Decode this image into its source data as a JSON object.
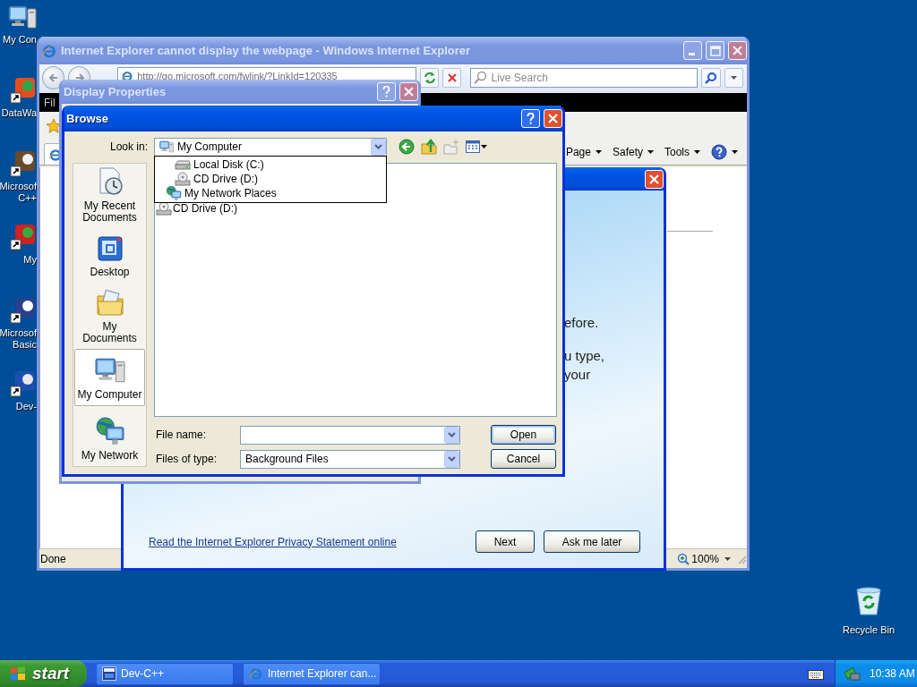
{
  "desktop": {
    "icons": [
      {
        "kind": "computer",
        "lines": [
          "My Con"
        ]
      },
      {
        "kind": "app",
        "lines": [
          "DataWa"
        ]
      },
      {
        "kind": "app",
        "lines": [
          "Microsof",
          "C++"
        ]
      },
      {
        "kind": "app",
        "lines": [
          "My"
        ]
      },
      {
        "kind": "app",
        "lines": [
          "Microsof",
          "Basic"
        ]
      },
      {
        "kind": "app",
        "lines": [
          "Dev-"
        ]
      }
    ],
    "recycle_bin": {
      "label": "Recycle Bin"
    }
  },
  "ie_window": {
    "active": false,
    "title": "Internet Explorer cannot display the webpage - Windows Internet Explorer",
    "address": "http://go.microsoft.com/fwlink/?LinkId=120335",
    "search": {
      "placeholder": "Live Search"
    },
    "menu": [
      "Fil"
    ],
    "commands": [
      "Page",
      "Safety",
      "Tools"
    ],
    "status": "Done",
    "zoom": "100%"
  },
  "setup_dialog": {
    "active": true,
    "paragraphs": [
      {
        "lines": [
          "efore."
        ]
      },
      {
        "lines": [
          "u type,",
          "your"
        ]
      }
    ],
    "link": "Read the Internet Explorer Privacy Statement online",
    "buttons": [
      "Next",
      "Ask me later"
    ]
  },
  "display_properties": {
    "active": false,
    "title": "Display Properties"
  },
  "browse_dialog": {
    "active": true,
    "title": "Browse",
    "look_in": {
      "label": "Look in:",
      "value": "My Computer",
      "options": [
        {
          "kind": "disk",
          "label": "Local Disk (C:)"
        },
        {
          "kind": "cd",
          "label": "CD Drive (D:)"
        },
        {
          "kind": "network",
          "label": "My Network Places"
        }
      ]
    },
    "files": [
      {
        "kind": "cd",
        "label": "CD Drive (D:)"
      }
    ],
    "places": [
      {
        "kind": "recent",
        "label": "My Recent Documents",
        "selected": false
      },
      {
        "kind": "desktop",
        "label": "Desktop",
        "selected": false
      },
      {
        "kind": "documents",
        "label": "My Documents",
        "selected": false
      },
      {
        "kind": "computer",
        "label": "My Computer",
        "selected": true
      },
      {
        "kind": "network",
        "label": "My Network",
        "selected": false
      }
    ],
    "file_name": {
      "label": "File name:"
    },
    "file_type": {
      "label": "Files of type:",
      "value": "Background Files"
    },
    "buttons": [
      "Open",
      "Cancel"
    ]
  },
  "taskbar": {
    "start": "start",
    "items": [
      {
        "kind": "devcpp",
        "label": "Dev-C++"
      },
      {
        "kind": "ie",
        "label": "Internet Explorer can..."
      }
    ],
    "clock": "10:38 AM"
  }
}
